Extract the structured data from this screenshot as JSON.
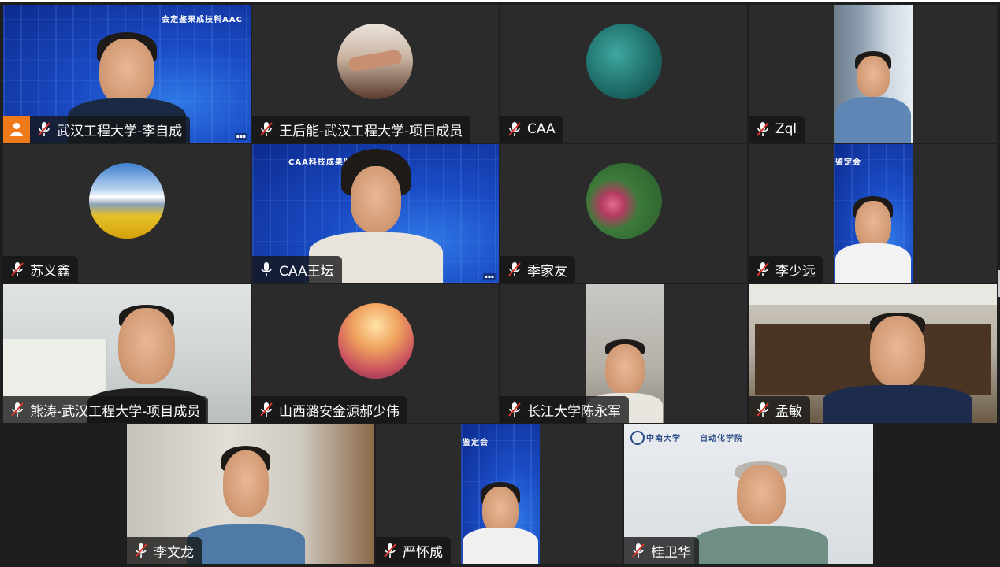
{
  "participants": [
    {
      "name": "武汉工程大学-李自成",
      "mic": "muted",
      "host": true
    },
    {
      "name": "王后能-武汉工程大学-项目成员",
      "mic": "muted",
      "avatar": "hands-photo"
    },
    {
      "name": "CAA",
      "mic": "muted",
      "avatar": "aquarium-photo"
    },
    {
      "name": "Zql",
      "mic": "muted"
    },
    {
      "name": "苏义鑫",
      "mic": "muted",
      "avatar": "landscape-photo"
    },
    {
      "name": "CAA王坛",
      "mic": "active"
    },
    {
      "name": "季家友",
      "mic": "muted",
      "avatar": "flowers-photo"
    },
    {
      "name": "李少远",
      "mic": "muted"
    },
    {
      "name": "熊涛-武汉工程大学-项目成员",
      "mic": "muted"
    },
    {
      "name": "山西潞安金源郝少伟",
      "mic": "muted",
      "avatar": "thumbs-up-photo"
    },
    {
      "name": "长江大学陈永军",
      "mic": "muted"
    },
    {
      "name": "孟敏",
      "mic": "muted"
    },
    {
      "name": "李文龙",
      "mic": "muted"
    },
    {
      "name": "严怀成",
      "mic": "muted"
    },
    {
      "name": "桂卫华",
      "mic": "muted"
    }
  ],
  "backgrounds": {
    "caa_banner_mirrored": "会定鉴果成技科AAC",
    "caa_banner": "CAA科技成果鉴定会",
    "banner_partial": "鉴定会",
    "csu_logo": "中南大学",
    "csu_dept": "自动化学院"
  },
  "colors": {
    "stage": "#1e1e1e",
    "tile": "#2b2b2b",
    "host_badge": "#f07a1a",
    "muted_slash": "#e0352b"
  }
}
